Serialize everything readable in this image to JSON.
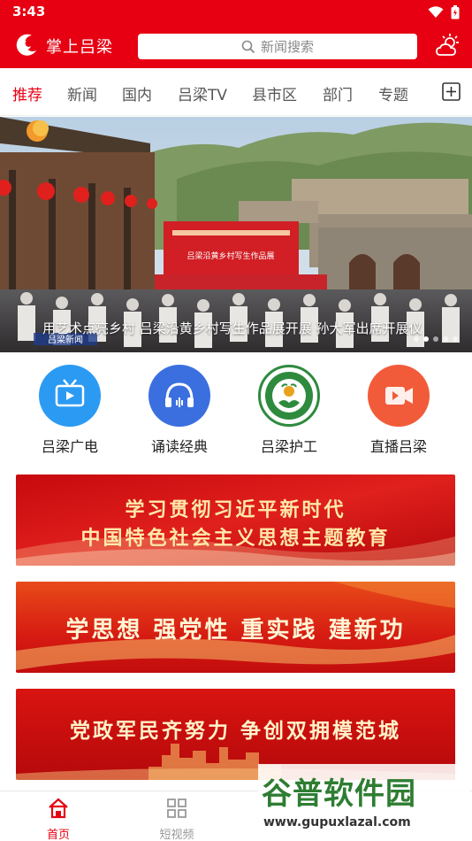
{
  "status": {
    "time": "3:43"
  },
  "app": {
    "title": "掌上吕梁",
    "search_placeholder": "新闻搜索"
  },
  "tabs": [
    {
      "label": "推荐",
      "active": true
    },
    {
      "label": "新闻",
      "active": false
    },
    {
      "label": "国内",
      "active": false
    },
    {
      "label": "吕梁TV",
      "active": false
    },
    {
      "label": "县市区",
      "active": false
    },
    {
      "label": "部门",
      "active": false
    },
    {
      "label": "专题",
      "active": false
    }
  ],
  "banner": {
    "caption": "用艺术点亮乡村 吕梁沿黄乡村写生作品展开展 孙大军出席开展仪",
    "backdrop_text": "吕梁沿黄乡村写生作品展",
    "station_logo": "吕梁新闻",
    "dots": 5,
    "active_dot": 1
  },
  "quick_entries": [
    {
      "label": "吕梁广电",
      "icon": "tv-icon",
      "color": "#2b9af3"
    },
    {
      "label": "诵读经典",
      "icon": "headphones-icon",
      "color": "#3b6fe0"
    },
    {
      "label": "吕梁护工",
      "icon": "nursing-emblem-icon",
      "color": "#2e8b3e"
    },
    {
      "label": "直播吕梁",
      "icon": "video-camera-icon",
      "color": "#f25b3a"
    }
  ],
  "promos": [
    {
      "line1": "学习贯彻习近平新时代",
      "line2": "中国特色社会主义思想主题教育"
    },
    {
      "line1": "学思想  强党性  重实践  建新功"
    },
    {
      "line1": "党政军民齐努力  争创双拥模范城"
    }
  ],
  "bottom_nav": [
    {
      "label": "首页",
      "active": true,
      "icon": "home-icon"
    },
    {
      "label": "短视频",
      "active": false,
      "icon": "grid-icon"
    }
  ],
  "watermark": {
    "title": "谷普软件园",
    "url": "www.gupuxlazal.com"
  },
  "colors": {
    "brand": "#e60012",
    "promo_red": "#d40f12"
  }
}
